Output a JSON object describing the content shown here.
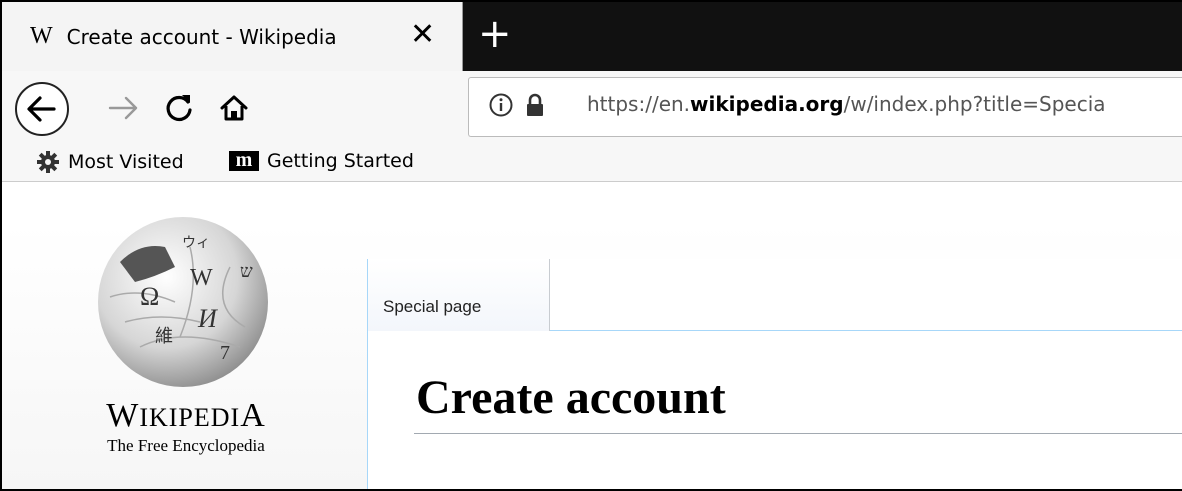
{
  "browser": {
    "tab": {
      "favicon": "W",
      "title": "Create account - Wikipedia",
      "close": "✕"
    },
    "new_tab": "+",
    "url": {
      "prefix": "https://en.",
      "domain": "wikipedia.org",
      "suffix": "/w/index.php?title=Specia"
    },
    "bookmarks": [
      {
        "icon": "gear-icon",
        "label": "Most Visited"
      },
      {
        "icon": "m-logo",
        "logo_text": "m",
        "label": "Getting Started"
      }
    ]
  },
  "sidebar": {
    "logo_word_first": "W",
    "logo_word_rest": "IKIPEDI",
    "logo_word_last": "A",
    "logo_tagline": "The Free Encyclopedia",
    "globe_glyphs": [
      "Ω",
      "W",
      "И",
      "維",
      "7",
      "ウィ",
      "ש"
    ]
  },
  "content": {
    "tab_label": "Special page",
    "heading": "Create account"
  }
}
